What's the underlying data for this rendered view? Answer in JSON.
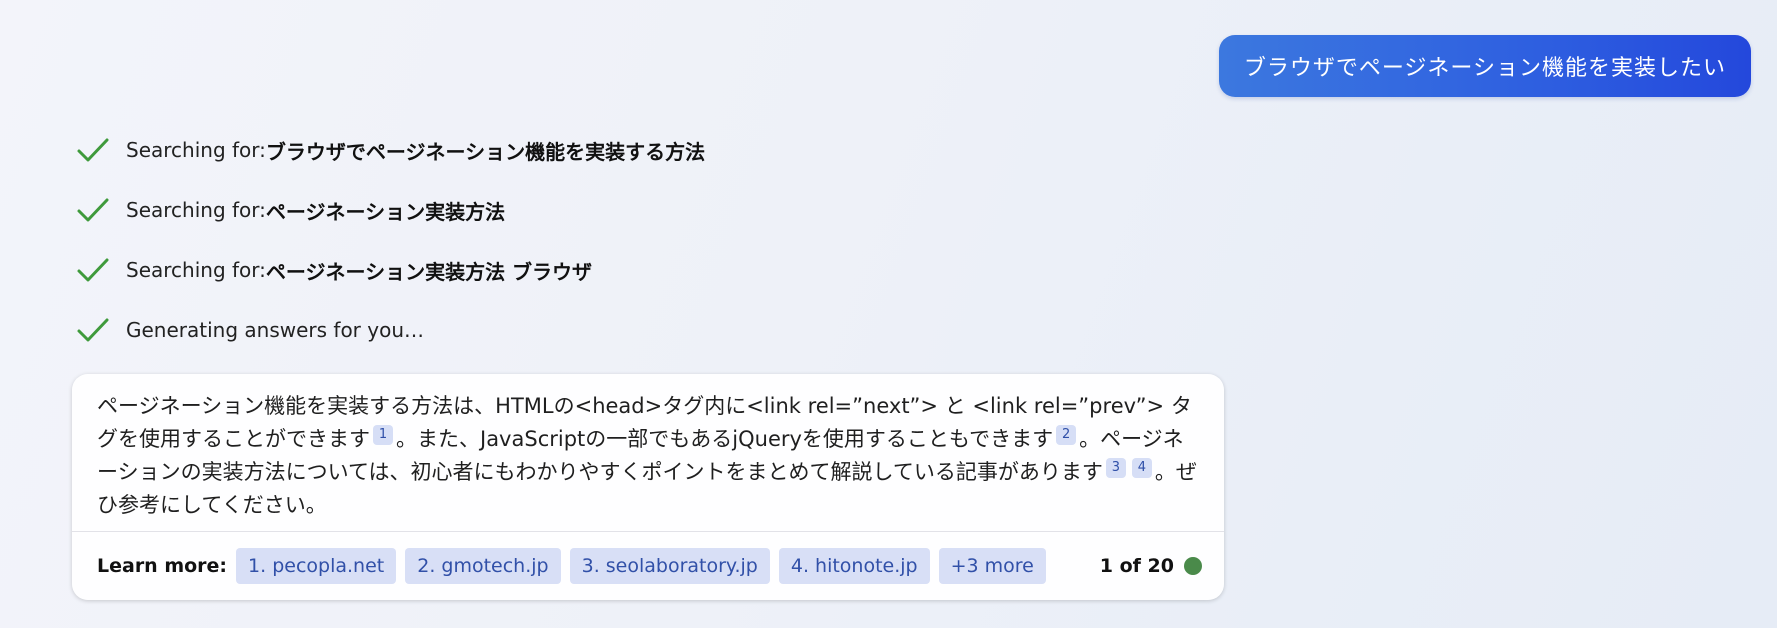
{
  "user_message": "ブラウザでページネーション機能を実装したい",
  "status_items": [
    {
      "prefix": "Searching for: ",
      "query": "ブラウザでページネーション機能を実装する方法"
    },
    {
      "prefix": "Searching for: ",
      "query": "ページネーション実装方法"
    },
    {
      "prefix": "Searching for: ",
      "query": "ページネーション実装方法 ブラウザ"
    },
    {
      "prefix": "Generating answers for you…",
      "query": ""
    }
  ],
  "answer": {
    "seg1": "ページネーション機能を実装する方法は、HTMLの<head>タグ内に<link rel=”next”> と <link rel=”prev”> タグを使用することができます",
    "cite1": "1",
    "seg2": "。また、JavaScriptの一部でもあるjQueryを使用することもできます",
    "cite2": "2",
    "seg3": "。ページネーションの実装方法については、初心者にもわかりやすくポイントをまとめて解説している記事があります",
    "cite3": "3",
    "cite4": "4",
    "seg4": "。ぜひ参考にしてください。"
  },
  "footer": {
    "learn_more_label": "Learn more:",
    "sources": [
      "1. pecopla.net",
      "2. gmotech.jp",
      "3. seolaboratory.jp",
      "4. hitonote.jp",
      "+3 more"
    ],
    "page_count": "1 of 20"
  },
  "colors": {
    "check": "#3f9a3c",
    "status_dot": "#4a8a4a",
    "accent": "#2e5fe0",
    "chip_bg": "#d8dff6",
    "chip_text": "#3150a8"
  },
  "icons": {
    "status": "check-icon",
    "indicator": "status-dot"
  }
}
